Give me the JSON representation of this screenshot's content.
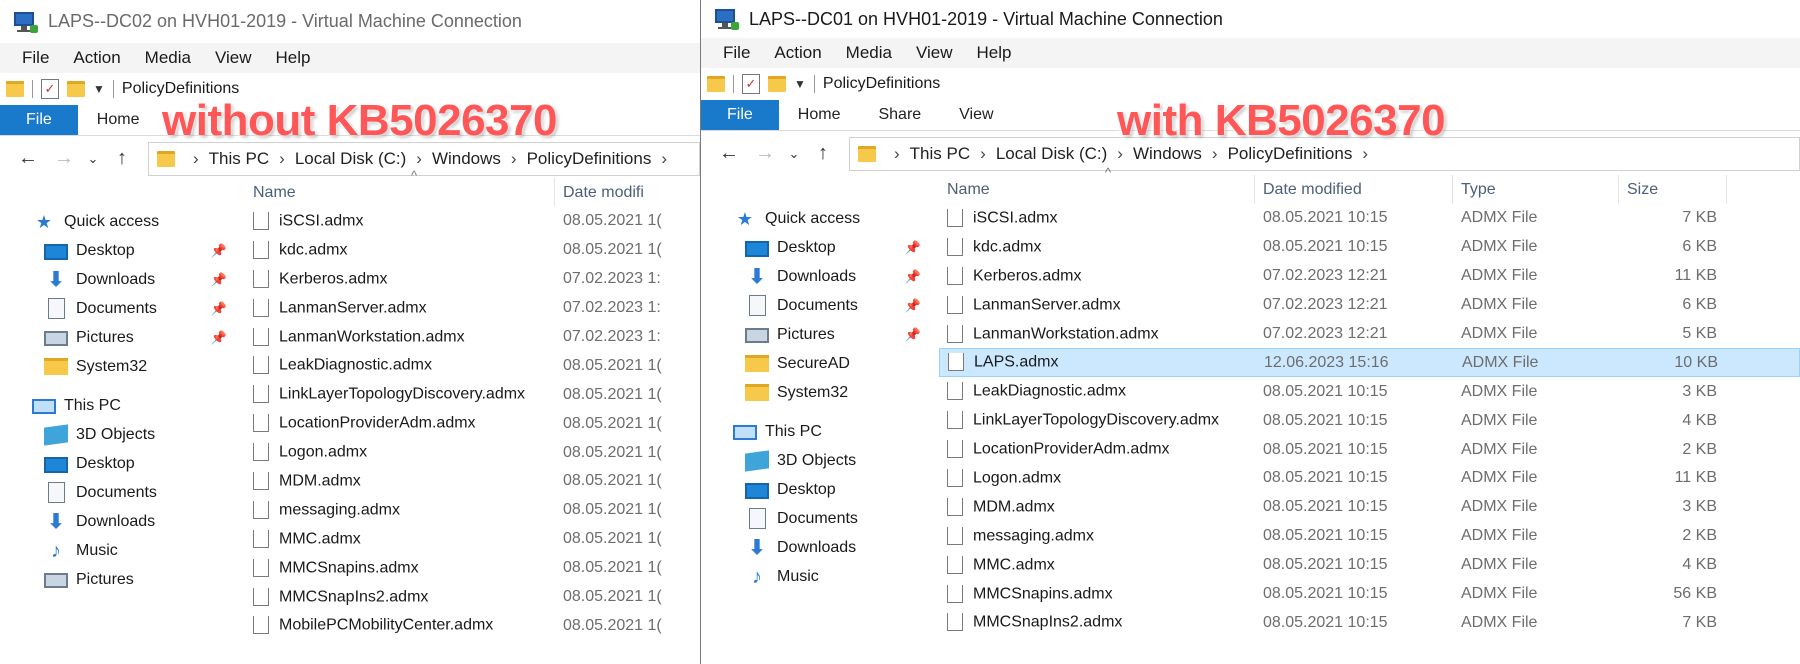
{
  "left": {
    "title": "LAPS--DC02 on HVH01-2019 - Virtual Machine Connection",
    "menu": [
      "File",
      "Action",
      "Media",
      "View",
      "Help"
    ],
    "qat_title": "PolicyDefinitions",
    "ribbon_tabs": [
      "File",
      "Home"
    ],
    "breadcrumb": [
      "This PC",
      "Local Disk (C:)",
      "Windows",
      "PolicyDefinitions"
    ],
    "overlay": "without KB5026370",
    "columns": {
      "name": "Name",
      "date": "Date modifi"
    },
    "nav": [
      {
        "label": "Quick access",
        "icon": "star-icon",
        "level": 0,
        "pin": false
      },
      {
        "label": "Desktop",
        "icon": "desktop-icon",
        "level": 1,
        "pin": true
      },
      {
        "label": "Downloads",
        "icon": "downloads-icon",
        "level": 1,
        "pin": true
      },
      {
        "label": "Documents",
        "icon": "documents-icon",
        "level": 1,
        "pin": true
      },
      {
        "label": "Pictures",
        "icon": "pictures-icon",
        "level": 1,
        "pin": true
      },
      {
        "label": "System32",
        "icon": "folder-icon",
        "level": 1,
        "pin": false
      },
      {
        "label": "This PC",
        "icon": "this-pc-icon",
        "level": 0,
        "pin": false
      },
      {
        "label": "3D Objects",
        "icon": "3d-objects-icon",
        "level": 1,
        "pin": false
      },
      {
        "label": "Desktop",
        "icon": "desktop-icon",
        "level": 1,
        "pin": false
      },
      {
        "label": "Documents",
        "icon": "documents-icon",
        "level": 1,
        "pin": false
      },
      {
        "label": "Downloads",
        "icon": "downloads-icon",
        "level": 1,
        "pin": false
      },
      {
        "label": "Music",
        "icon": "music-icon",
        "level": 1,
        "pin": false
      },
      {
        "label": "Pictures",
        "icon": "pictures-icon",
        "level": 1,
        "pin": false
      }
    ],
    "files": [
      {
        "name": "iSCSI.admx",
        "date": "08.05.2021 1("
      },
      {
        "name": "kdc.admx",
        "date": "08.05.2021 1("
      },
      {
        "name": "Kerberos.admx",
        "date": "07.02.2023 1:"
      },
      {
        "name": "LanmanServer.admx",
        "date": "07.02.2023 1:"
      },
      {
        "name": "LanmanWorkstation.admx",
        "date": "07.02.2023 1:"
      },
      {
        "name": "LeakDiagnostic.admx",
        "date": "08.05.2021 1("
      },
      {
        "name": "LinkLayerTopologyDiscovery.admx",
        "date": "08.05.2021 1("
      },
      {
        "name": "LocationProviderAdm.admx",
        "date": "08.05.2021 1("
      },
      {
        "name": "Logon.admx",
        "date": "08.05.2021 1("
      },
      {
        "name": "MDM.admx",
        "date": "08.05.2021 1("
      },
      {
        "name": "messaging.admx",
        "date": "08.05.2021 1("
      },
      {
        "name": "MMC.admx",
        "date": "08.05.2021 1("
      },
      {
        "name": "MMCSnapins.admx",
        "date": "08.05.2021 1("
      },
      {
        "name": "MMCSnapIns2.admx",
        "date": "08.05.2021 1("
      },
      {
        "name": "MobilePCMobilityCenter.admx",
        "date": "08.05.2021 1("
      }
    ]
  },
  "right": {
    "title": "LAPS--DC01 on HVH01-2019 - Virtual Machine Connection",
    "menu": [
      "File",
      "Action",
      "Media",
      "View",
      "Help"
    ],
    "qat_title": "PolicyDefinitions",
    "ribbon_tabs": [
      "File",
      "Home",
      "Share",
      "View"
    ],
    "breadcrumb": [
      "This PC",
      "Local Disk (C:)",
      "Windows",
      "PolicyDefinitions"
    ],
    "overlay": "with KB5026370",
    "columns": {
      "name": "Name",
      "date": "Date modified",
      "type": "Type",
      "size": "Size"
    },
    "nav": [
      {
        "label": "Quick access",
        "icon": "star-icon",
        "level": 0,
        "pin": false
      },
      {
        "label": "Desktop",
        "icon": "desktop-icon",
        "level": 1,
        "pin": true
      },
      {
        "label": "Downloads",
        "icon": "downloads-icon",
        "level": 1,
        "pin": true
      },
      {
        "label": "Documents",
        "icon": "documents-icon",
        "level": 1,
        "pin": true
      },
      {
        "label": "Pictures",
        "icon": "pictures-icon",
        "level": 1,
        "pin": true
      },
      {
        "label": "SecureAD",
        "icon": "folder-icon",
        "level": 1,
        "pin": false
      },
      {
        "label": "System32",
        "icon": "folder-icon",
        "level": 1,
        "pin": false
      },
      {
        "label": "This PC",
        "icon": "this-pc-icon",
        "level": 0,
        "pin": false
      },
      {
        "label": "3D Objects",
        "icon": "3d-objects-icon",
        "level": 1,
        "pin": false
      },
      {
        "label": "Desktop",
        "icon": "desktop-icon",
        "level": 1,
        "pin": false
      },
      {
        "label": "Documents",
        "icon": "documents-icon",
        "level": 1,
        "pin": false
      },
      {
        "label": "Downloads",
        "icon": "downloads-icon",
        "level": 1,
        "pin": false
      },
      {
        "label": "Music",
        "icon": "music-icon",
        "level": 1,
        "pin": false
      }
    ],
    "files": [
      {
        "name": "iSCSI.admx",
        "date": "08.05.2021 10:15",
        "type": "ADMX File",
        "size": "7 KB"
      },
      {
        "name": "kdc.admx",
        "date": "08.05.2021 10:15",
        "type": "ADMX File",
        "size": "6 KB"
      },
      {
        "name": "Kerberos.admx",
        "date": "07.02.2023 12:21",
        "type": "ADMX File",
        "size": "11 KB"
      },
      {
        "name": "LanmanServer.admx",
        "date": "07.02.2023 12:21",
        "type": "ADMX File",
        "size": "6 KB"
      },
      {
        "name": "LanmanWorkstation.admx",
        "date": "07.02.2023 12:21",
        "type": "ADMX File",
        "size": "5 KB"
      },
      {
        "name": "LAPS.admx",
        "date": "12.06.2023 15:16",
        "type": "ADMX File",
        "size": "10 KB",
        "selected": true
      },
      {
        "name": "LeakDiagnostic.admx",
        "date": "08.05.2021 10:15",
        "type": "ADMX File",
        "size": "3 KB"
      },
      {
        "name": "LinkLayerTopologyDiscovery.admx",
        "date": "08.05.2021 10:15",
        "type": "ADMX File",
        "size": "4 KB"
      },
      {
        "name": "LocationProviderAdm.admx",
        "date": "08.05.2021 10:15",
        "type": "ADMX File",
        "size": "2 KB"
      },
      {
        "name": "Logon.admx",
        "date": "08.05.2021 10:15",
        "type": "ADMX File",
        "size": "11 KB"
      },
      {
        "name": "MDM.admx",
        "date": "08.05.2021 10:15",
        "type": "ADMX File",
        "size": "3 KB"
      },
      {
        "name": "messaging.admx",
        "date": "08.05.2021 10:15",
        "type": "ADMX File",
        "size": "2 KB"
      },
      {
        "name": "MMC.admx",
        "date": "08.05.2021 10:15",
        "type": "ADMX File",
        "size": "4 KB"
      },
      {
        "name": "MMCSnapins.admx",
        "date": "08.05.2021 10:15",
        "type": "ADMX File",
        "size": "56 KB"
      },
      {
        "name": "MMCSnapIns2.admx",
        "date": "08.05.2021 10:15",
        "type": "ADMX File",
        "size": "7 KB"
      }
    ]
  }
}
